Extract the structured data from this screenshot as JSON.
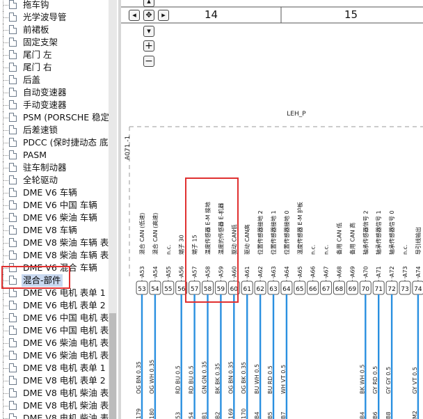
{
  "sidebar": {
    "items": [
      {
        "label": "拖车钩"
      },
      {
        "label": "光学波导管"
      },
      {
        "label": "前裙板"
      },
      {
        "label": "固定支架"
      },
      {
        "label": "尾门 左"
      },
      {
        "label": "尾门 右"
      },
      {
        "label": "后盖"
      },
      {
        "label": "自动变速器"
      },
      {
        "label": "手动变速器"
      },
      {
        "label": "PSM (PORSCHE 稳定"
      },
      {
        "label": "后差速锁"
      },
      {
        "label": "PDCC (保时捷动态 底"
      },
      {
        "label": "PASM"
      },
      {
        "label": "驻车制动器"
      },
      {
        "label": "全轮驱动"
      },
      {
        "label": "DME V6 车辆"
      },
      {
        "label": "DME V6 中国 车辆"
      },
      {
        "label": "DME V6 柴油 车辆"
      },
      {
        "label": "DME V8 车辆"
      },
      {
        "label": "DME V8 柴油 车辆 表"
      },
      {
        "label": "DME V8 柴油 车辆 表"
      },
      {
        "label": "DME V6 混合 车辆"
      },
      {
        "label": "混合-部件"
      },
      {
        "label": "DME V6 电机 表单 1"
      },
      {
        "label": "DME V6 电机 表单 2"
      },
      {
        "label": "DME V6 中国 电机 表"
      },
      {
        "label": "DME V6 中国 电机 表"
      },
      {
        "label": "DME V6 柴油 电机 表"
      },
      {
        "label": "DME V6 柴油 电机 表"
      },
      {
        "label": "DME V8 电机 表单 1"
      },
      {
        "label": "DME V8 电机 表单 2"
      },
      {
        "label": "DME V8 电机 柴油 表"
      },
      {
        "label": "DME V8 电机 柴油 表"
      },
      {
        "label": "DME V8 电机 柴油 表"
      }
    ],
    "selected_index": 22
  },
  "diagram": {
    "zone_labels": [
      "14",
      "15"
    ],
    "component_label": "LEH_P",
    "component_id": "A071 -1",
    "pins": [
      {
        "pin_label": "A53",
        "desc": "混合 CAN (低速)",
        "num": "53",
        "wire": "OG BN 0.35",
        "wire_num": "179"
      },
      {
        "pin_label": "A54",
        "desc": "混合 CAN (高速)",
        "num": "54",
        "wire": "OG WH 0.35",
        "wire_num": "180"
      },
      {
        "pin_label": "A55",
        "desc": "n.c.",
        "num": "55",
        "wire": "",
        "wire_num": ""
      },
      {
        "pin_label": "A56",
        "desc": "端子 30",
        "num": "56",
        "wire": "RD BU 0.5",
        "wire_num": "53"
      },
      {
        "pin_label": "A57",
        "desc": "端子 15",
        "num": "57",
        "wire": "RD BU 0.5",
        "wire_num": "54"
      },
      {
        "pin_label": "A58",
        "desc": "温度传感器 E-M 接地",
        "num": "58",
        "wire": "GN GN 0.35",
        "wire_num": "B1"
      },
      {
        "pin_label": "A59",
        "desc": "温度的传感器 E-机器",
        "num": "59",
        "wire": "BK BK 0.35",
        "wire_num": "B2"
      },
      {
        "pin_label": "A60",
        "desc": "驱动 CAN低",
        "num": "60",
        "wire": "OG BN 0.35",
        "wire_num": "169"
      },
      {
        "pin_label": "A61",
        "desc": "驱动 CAN高",
        "num": "61",
        "wire": "OG BK 0.35",
        "wire_num": "170"
      },
      {
        "pin_label": "A62",
        "desc": "位置传感器接地 2",
        "num": "62",
        "wire": "BU WH 0.5",
        "wire_num": "B4"
      },
      {
        "pin_label": "A63",
        "desc": "位置传感器接地 1",
        "num": "63",
        "wire": "BU RD 0.5",
        "wire_num": "B5"
      },
      {
        "pin_label": "A64",
        "desc": "位置传感器接地 0",
        "num": "64",
        "wire": "WH VT 0.5",
        "wire_num": "B7"
      },
      {
        "pin_label": "A65",
        "desc": "温度传感器 E-M 护板",
        "num": "65",
        "wire": "",
        "wire_num": ""
      },
      {
        "pin_label": "A66",
        "desc": "n.c.",
        "num": "66",
        "wire": "",
        "wire_num": ""
      },
      {
        "pin_label": "A67",
        "desc": "n.c.",
        "num": "67",
        "wire": "",
        "wire_num": ""
      },
      {
        "pin_label": "A68",
        "desc": "备用 CAN 低",
        "num": "68",
        "wire": "",
        "wire_num": ""
      },
      {
        "pin_label": "A69",
        "desc": "备用 CAN 高",
        "num": "69",
        "wire": "",
        "wire_num": ""
      },
      {
        "pin_label": "A70",
        "desc": "轴承传感器信号 2",
        "num": "70",
        "wire": "BK WH 0.5",
        "wire_num": "B4"
      },
      {
        "pin_label": "A71",
        "desc": "轴承传感器信号 1",
        "num": "71",
        "wire": "GY RD 0.5",
        "wire_num": "B6"
      },
      {
        "pin_label": "A72",
        "desc": "轴承传感器信号 0",
        "num": "72",
        "wire": "GY GY 0.5",
        "wire_num": "B8"
      },
      {
        "pin_label": "A73",
        "desc": "n.c.",
        "num": "73",
        "wire": "",
        "wire_num": ""
      },
      {
        "pin_label": "A74",
        "desc": "导引线输出",
        "num": "74",
        "wire": "GY VT 0.5",
        "wire_num": "M2"
      }
    ],
    "colors": {
      "wire": "#2a90e0",
      "highlight": "#e03030",
      "dash": "#999999"
    }
  }
}
